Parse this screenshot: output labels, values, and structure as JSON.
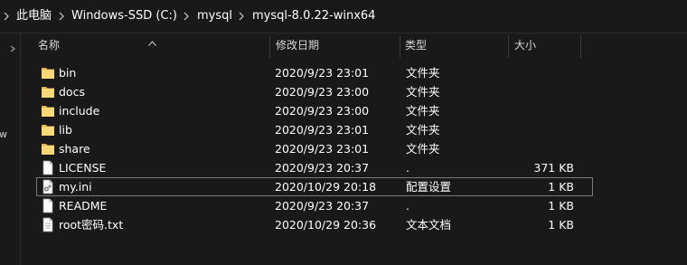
{
  "breadcrumb": [
    "此电脑",
    "Windows-SSD (C:)",
    "mysql",
    "mysql-8.0.22-winx64"
  ],
  "columns": {
    "name": "名称",
    "date": "修改日期",
    "type": "类型",
    "size": "大小"
  },
  "sort": {
    "column": "name",
    "direction": "ascending"
  },
  "nav": {
    "partial_letter": "w"
  },
  "files": [
    {
      "name": "bin",
      "date": "2020/9/23 23:01",
      "type": "文件夹",
      "size": "",
      "icon": "folder-icon"
    },
    {
      "name": "docs",
      "date": "2020/9/23 23:00",
      "type": "文件夹",
      "size": "",
      "icon": "folder-icon"
    },
    {
      "name": "include",
      "date": "2020/9/23 23:00",
      "type": "文件夹",
      "size": "",
      "icon": "folder-icon"
    },
    {
      "name": "lib",
      "date": "2020/9/23 23:01",
      "type": "文件夹",
      "size": "",
      "icon": "folder-icon"
    },
    {
      "name": "share",
      "date": "2020/9/23 23:01",
      "type": "文件夹",
      "size": "",
      "icon": "folder-icon"
    },
    {
      "name": "LICENSE",
      "date": "2020/9/23 20:37",
      "type": ".",
      "size": "371 KB",
      "icon": "file-icon"
    },
    {
      "name": "my.ini",
      "date": "2020/10/29 20:18",
      "type": "配置设置",
      "size": "1 KB",
      "icon": "config-file-icon",
      "selected": true
    },
    {
      "name": "README",
      "date": "2020/9/23 20:37",
      "type": ".",
      "size": "1 KB",
      "icon": "file-icon"
    },
    {
      "name": "root密码.txt",
      "date": "2020/10/29 20:36",
      "type": "文本文档",
      "size": "1 KB",
      "icon": "text-file-icon"
    }
  ],
  "colors": {
    "background": "#191919",
    "text": "#ffffff",
    "folder": "#f8d775",
    "selection_border": "#7a7a7a"
  }
}
